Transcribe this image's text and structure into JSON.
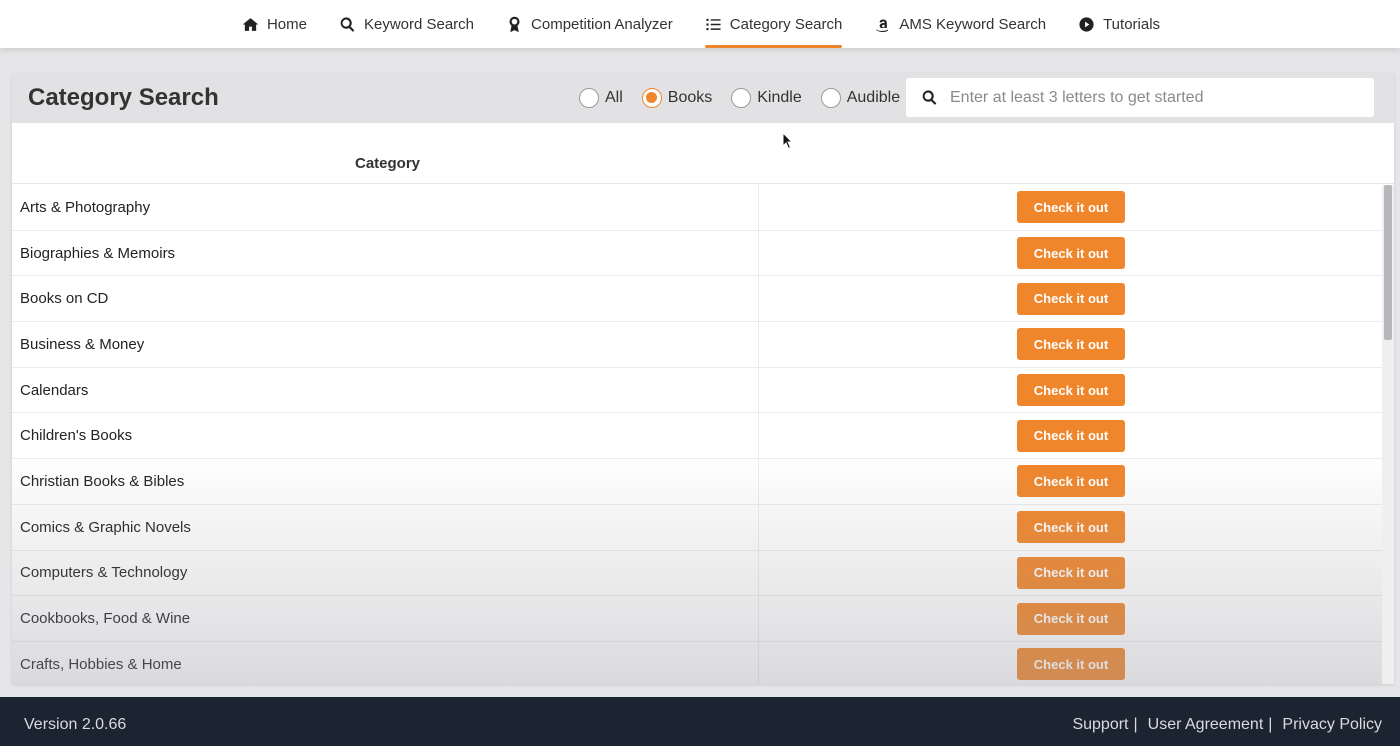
{
  "nav": {
    "items": [
      {
        "label": "Home",
        "icon": "home-icon"
      },
      {
        "label": "Keyword Search",
        "icon": "search-icon"
      },
      {
        "label": "Competition Analyzer",
        "icon": "award-icon"
      },
      {
        "label": "Category Search",
        "icon": "list-icon",
        "active": true
      },
      {
        "label": "AMS Keyword Search",
        "icon": "amazon-icon"
      },
      {
        "label": "Tutorials",
        "icon": "play-icon"
      }
    ]
  },
  "panel": {
    "title": "Category Search",
    "filters": [
      {
        "label": "All",
        "checked": false
      },
      {
        "label": "Books",
        "checked": true
      },
      {
        "label": "Kindle",
        "checked": false
      },
      {
        "label": "Audible",
        "checked": false
      }
    ],
    "search": {
      "placeholder": "Enter at least 3 letters to get started",
      "value": ""
    },
    "column_header": "Category",
    "button_label": "Check it out",
    "rows": [
      "Arts & Photography",
      "Biographies & Memoirs",
      "Books on CD",
      "Business & Money",
      "Calendars",
      "Children's Books",
      "Christian Books & Bibles",
      "Comics & Graphic Novels",
      "Computers & Technology",
      "Cookbooks, Food & Wine",
      "Crafts, Hobbies & Home"
    ]
  },
  "footer": {
    "version": "Version 2.0.66",
    "links": [
      "Support",
      "User Agreement",
      "Privacy Policy"
    ],
    "separator": "|"
  },
  "colors": {
    "accent": "#f0862b",
    "footer_bg": "#1c2431",
    "header_bg": "#e2e2e4"
  }
}
